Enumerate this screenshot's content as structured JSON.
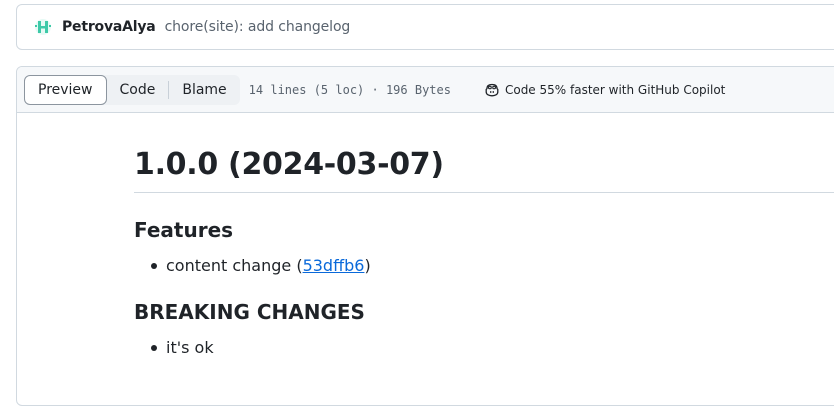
{
  "commit": {
    "author": "PetrovaAlya",
    "message": "chore(site): add changelog"
  },
  "file_header": {
    "tabs": [
      "Preview",
      "Code",
      "Blame"
    ],
    "active_tab": "Preview",
    "meta": "14 lines (5 loc) · 196 Bytes",
    "copilot_text": "Code 55% faster with GitHub Copilot"
  },
  "markdown": {
    "title": "1.0.0 (2024-03-07)",
    "sections": [
      {
        "heading": "Features",
        "items": [
          {
            "prefix": "content change (",
            "link": "53dffb6",
            "suffix": ")"
          }
        ]
      },
      {
        "heading": "BREAKING CHANGES",
        "items": [
          {
            "text": "it's ok"
          }
        ]
      }
    ]
  },
  "colors": {
    "link": "#0969da",
    "border": "#d1d9e0",
    "header_bg": "#f6f8fa",
    "muted": "#59636e",
    "avatar": "#3dc9a8"
  }
}
